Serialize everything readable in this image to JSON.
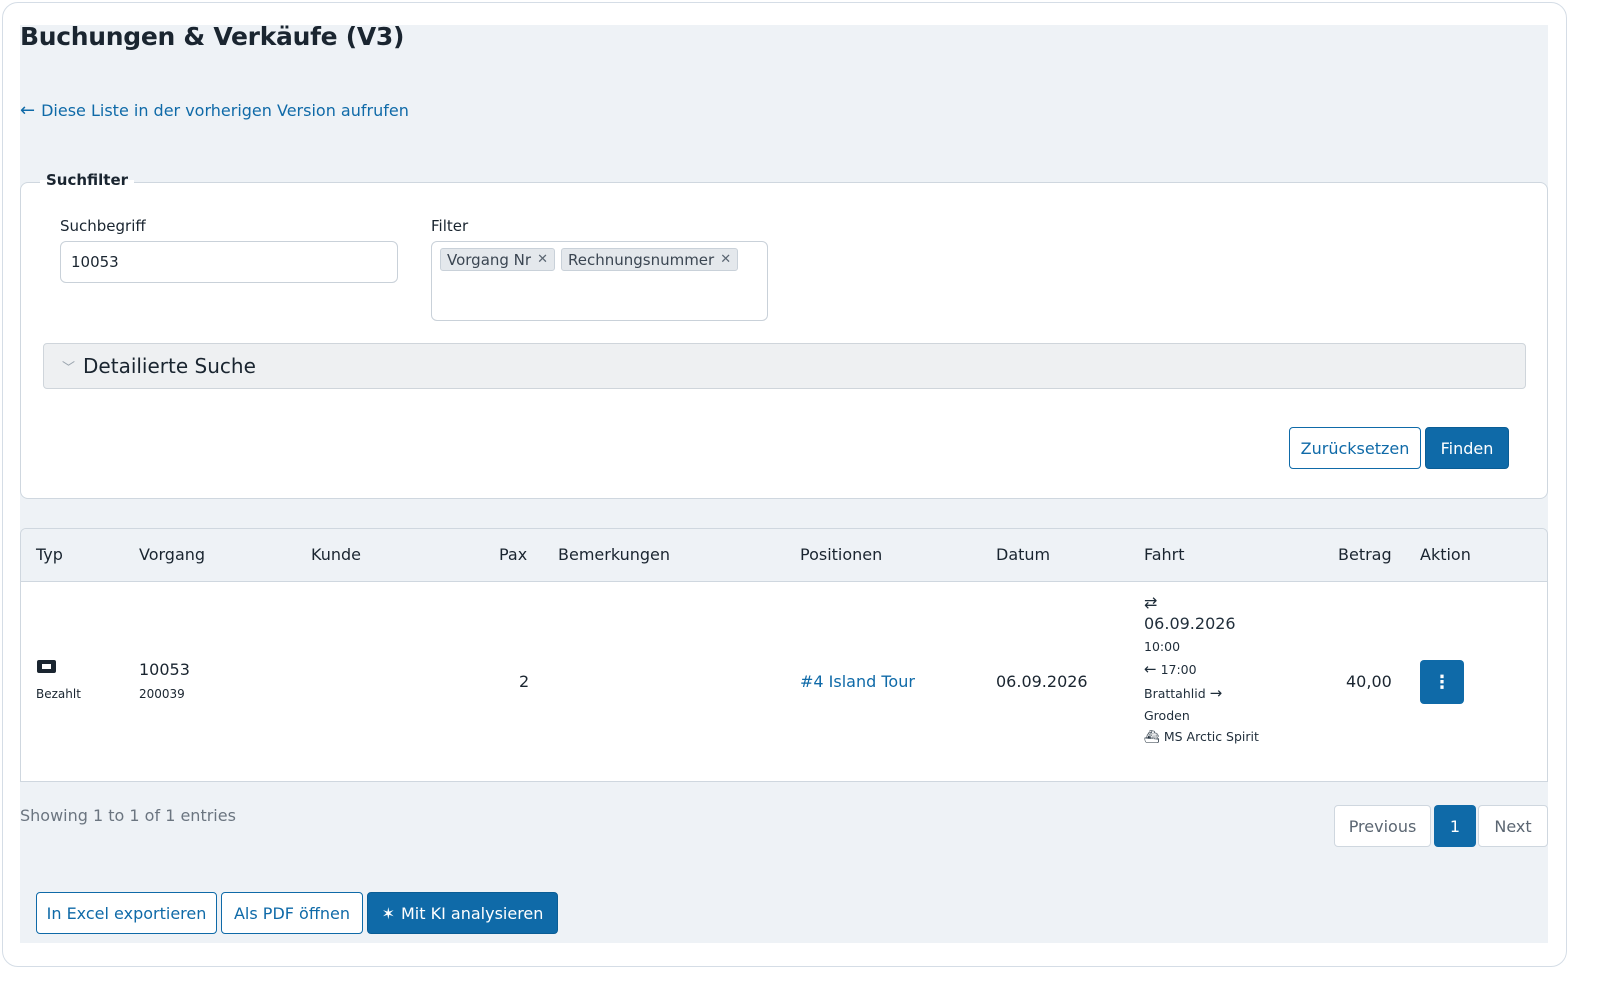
{
  "page": {
    "title": "Buchungen & Verkäufe (V3)",
    "back_link": "Diese Liste in der vorherigen Version aufrufen"
  },
  "filter": {
    "legend": "Suchfilter",
    "search_label": "Suchbegriff",
    "search_value": "10053",
    "filter_label": "Filter",
    "tags": [
      "Vorgang Nr",
      "Rechnungsnummer"
    ],
    "detail_search": "Detailierte Suche",
    "reset_button": "Zurücksetzen",
    "find_button": "Finden"
  },
  "table": {
    "headers": [
      "Typ",
      "Vorgang",
      "Kunde",
      "Pax",
      "Bemerkungen",
      "Positionen",
      "Datum",
      "Fahrt",
      "Betrag",
      "Aktion"
    ],
    "rows": [
      {
        "typ_icon": "ticket-icon",
        "typ_status": "Bezahlt",
        "vorgang": "10053",
        "vorgang_sub": "200039",
        "kunde": "",
        "pax": "2",
        "bemerkungen": "",
        "positionen": "#4 Island Tour",
        "datum": "06.09.2026",
        "fahrt": {
          "icon": "round-trip-icon",
          "date": "06.09.2026",
          "time_out": "10:00",
          "return_icon": "arrow-left-icon",
          "time_back": "17:00",
          "from": "Brattahlid",
          "route_icon": "arrow-right-icon",
          "to": "Groden",
          "ship_icon": "ship-icon",
          "ship": "MS Arctic Spirit"
        },
        "betrag": "40,00",
        "action_icon": "more-vertical-icon"
      }
    ]
  },
  "pagination": {
    "showing": "Showing 1 to 1 of 1 entries",
    "previous": "Previous",
    "current": "1",
    "next": "Next"
  },
  "actions": {
    "excel": "In Excel exportieren",
    "pdf": "Als PDF öffnen",
    "ai": "Mit KI analysieren",
    "ai_icon": "magic-wand-icon"
  },
  "colors": {
    "accent": "#0f6aa8",
    "page_bg": "#eef2f6",
    "text": "#1a2530"
  }
}
